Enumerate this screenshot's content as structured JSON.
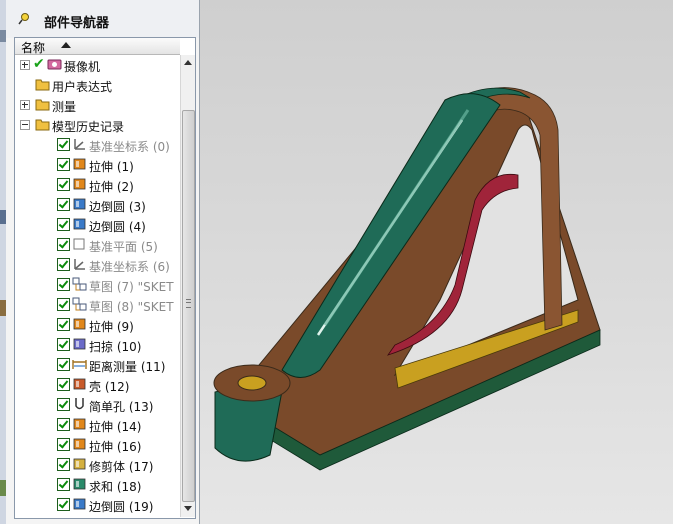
{
  "navigator": {
    "title": "部件导航器",
    "column_name": "名称",
    "rows": [
      {
        "label": "摄像机",
        "icon": "camera-icon"
      },
      {
        "label": "用户表达式",
        "icon": "folder-icon"
      },
      {
        "label": "测量",
        "icon": "folder-icon"
      },
      {
        "label": "模型历史记录",
        "icon": "folder-open-icon"
      },
      {
        "label": "基准坐标系 (0)",
        "icon": "datum-csys-icon"
      },
      {
        "label": "拉伸 (1)",
        "icon": "extrude-icon"
      },
      {
        "label": "拉伸 (2)",
        "icon": "extrude-icon"
      },
      {
        "label": "边倒圆 (3)",
        "icon": "edge-blend-icon"
      },
      {
        "label": "边倒圆 (4)",
        "icon": "edge-blend-icon"
      },
      {
        "label": "基准平面 (5)",
        "icon": "datum-plane-icon"
      },
      {
        "label": "基准坐标系 (6)",
        "icon": "datum-csys-icon"
      },
      {
        "label": "草图 (7) \"SKET",
        "icon": "sketch-icon"
      },
      {
        "label": "草图 (8) \"SKET",
        "icon": "sketch-icon"
      },
      {
        "label": "拉伸 (9)",
        "icon": "extrude-icon"
      },
      {
        "label": "扫掠 (10)",
        "icon": "swept-icon"
      },
      {
        "label": "距离测量 (11)",
        "icon": "measure-distance-icon"
      },
      {
        "label": "壳 (12)",
        "icon": "shell-icon"
      },
      {
        "label": "简单孔 (13)",
        "icon": "hole-icon"
      },
      {
        "label": "拉伸 (14)",
        "icon": "extrude-icon"
      },
      {
        "label": "拉伸 (16)",
        "icon": "extrude-icon"
      },
      {
        "label": "修剪体 (17)",
        "icon": "trim-body-icon"
      },
      {
        "label": "求和 (18)",
        "icon": "unite-icon"
      },
      {
        "label": "边倒圆 (19)",
        "icon": "edge-blend-icon"
      }
    ]
  },
  "colors": {
    "part_brown": "#7a4a2a",
    "part_green": "#1f6b57",
    "part_red": "#a0243a",
    "part_yellow": "#c9a020",
    "checkbox_green": "#0a8a0a"
  }
}
